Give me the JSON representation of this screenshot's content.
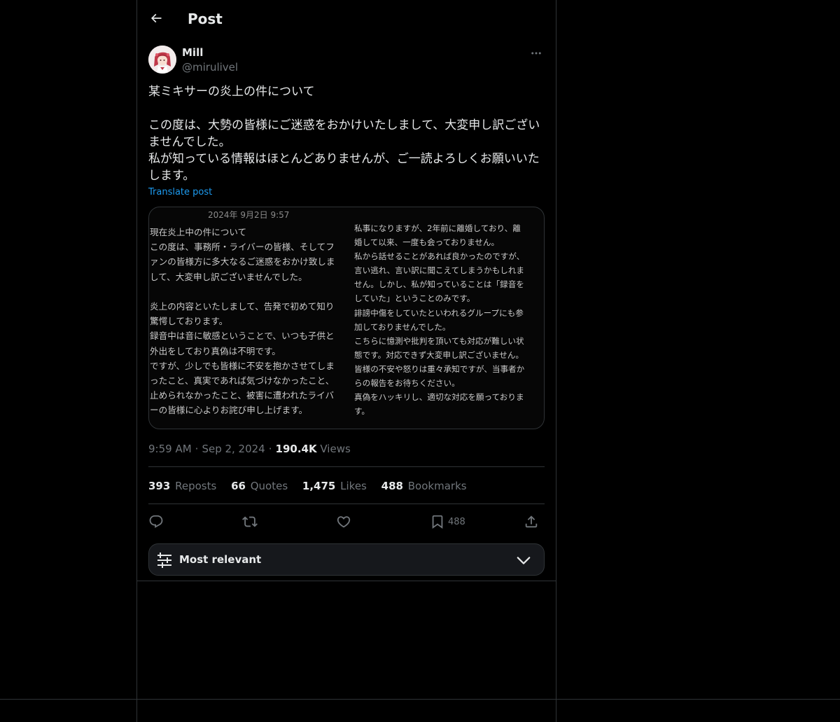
{
  "header": {
    "back_icon": "arrow-left-icon",
    "title": "Post"
  },
  "author": {
    "name": "Mill",
    "handle": "@mirulivel",
    "more_icon": "more-horizontal-icon"
  },
  "post": {
    "line1": "某ミキサーの炎上の件について",
    "line2": "この度は、大勢の皆様にご迷惑をおかけいたしまして、大変申し訳ござい",
    "line3": "ませんでした。",
    "line4": "私が知っている情報はほとんどありませんが、ご一読よろしくお願いいた",
    "line5": "します。",
    "translate": "Translate post"
  },
  "image": {
    "date": "2024年 9月2日 9:57",
    "left_lines": [
      "現在炎上中の件について",
      "この度は、事務所・ライバーの皆様、そしてフ",
      "ァンの皆様方に多大なるご迷惑をおかけ致しま",
      "して、大変申し訳ございませんでした。",
      "",
      "炎上の内容といたしまして、告発で初めて知り",
      "驚愕しております。",
      "録音中は音に敏感ということで、いつも子供と",
      "外出をしており真偽は不明です。",
      "ですが、少しでも皆様に不安を抱かさせてしま",
      "ったこと、真実であれば気づけなかったこと、",
      "止められなかったこと、被害に遭われたライバ",
      "ーの皆様に心よりお詫び申し上げます。"
    ],
    "right_lines": [
      "私事になりますが、2年前に離婚しており、離",
      "婚して以来、一度も会っておりません。",
      "私から話せることがあれば良かったのですが、",
      "言い逃れ、言い訳に聞こえてしまうかもしれま",
      "せん。しかし、私が知っていることは「録音を",
      "していた」ということのみです。",
      "誹謗中傷をしていたといわれるグループにも参",
      "加しておりませんでした。",
      "こちらに憶測や批判を頂いても対応が難しい状",
      "態です。対応できず大変申し訳ございません。",
      "皆様の不安や怒りは重々承知ですが、当事者か",
      "らの報告をお待ちください。",
      "真偽をハッキリし、適切な対応を願っておりま",
      "す。"
    ]
  },
  "meta": {
    "time": "9:59 AM",
    "date": "Sep 2, 2024",
    "views_count": "190.4K",
    "views_label": "Views"
  },
  "stats": {
    "reposts_count": "393",
    "reposts_label": "Reposts",
    "quotes_count": "66",
    "quotes_label": "Quotes",
    "likes_count": "1,475",
    "likes_label": "Likes",
    "bookmarks_count": "488",
    "bookmarks_label": "Bookmarks"
  },
  "actions": {
    "reply_icon": "reply-icon",
    "repost_icon": "repost-icon",
    "like_icon": "heart-icon",
    "bookmark_icon": "bookmark-icon",
    "bookmark_count": "488",
    "share_icon": "share-icon"
  },
  "sort": {
    "label": "Most relevant",
    "icon": "sliders-icon",
    "chevron": "chevron-down-icon"
  },
  "colors": {
    "background": "#000000",
    "text": "#e7e9ea",
    "muted": "#71767b",
    "link": "#1d9bf0",
    "border": "#2f3336"
  }
}
